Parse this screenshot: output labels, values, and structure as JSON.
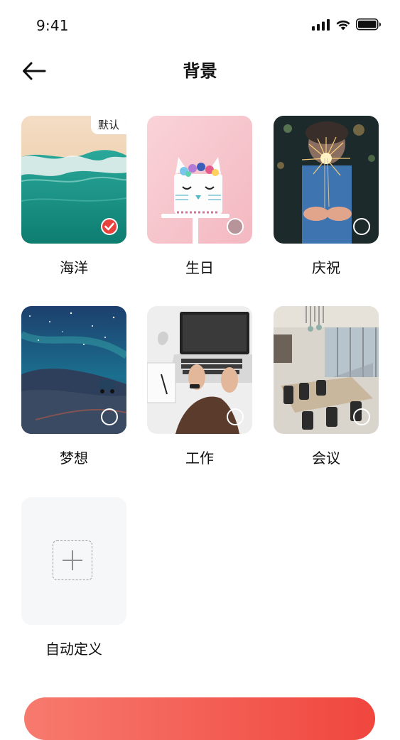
{
  "status_bar": {
    "time": "9:41"
  },
  "header": {
    "title": "背景"
  },
  "backgrounds": [
    {
      "label": "海洋",
      "badge": "默认",
      "selected": true
    },
    {
      "label": "生日",
      "selected": false
    },
    {
      "label": "庆祝",
      "selected": false
    },
    {
      "label": "梦想",
      "selected": false
    },
    {
      "label": "工作",
      "selected": false
    },
    {
      "label": "会议",
      "selected": false
    }
  ],
  "custom": {
    "label": "自动定义",
    "icon": "plus-icon"
  },
  "colors": {
    "accent": "#e8413e",
    "button_start": "#f77a6e",
    "button_end": "#f0463e"
  }
}
